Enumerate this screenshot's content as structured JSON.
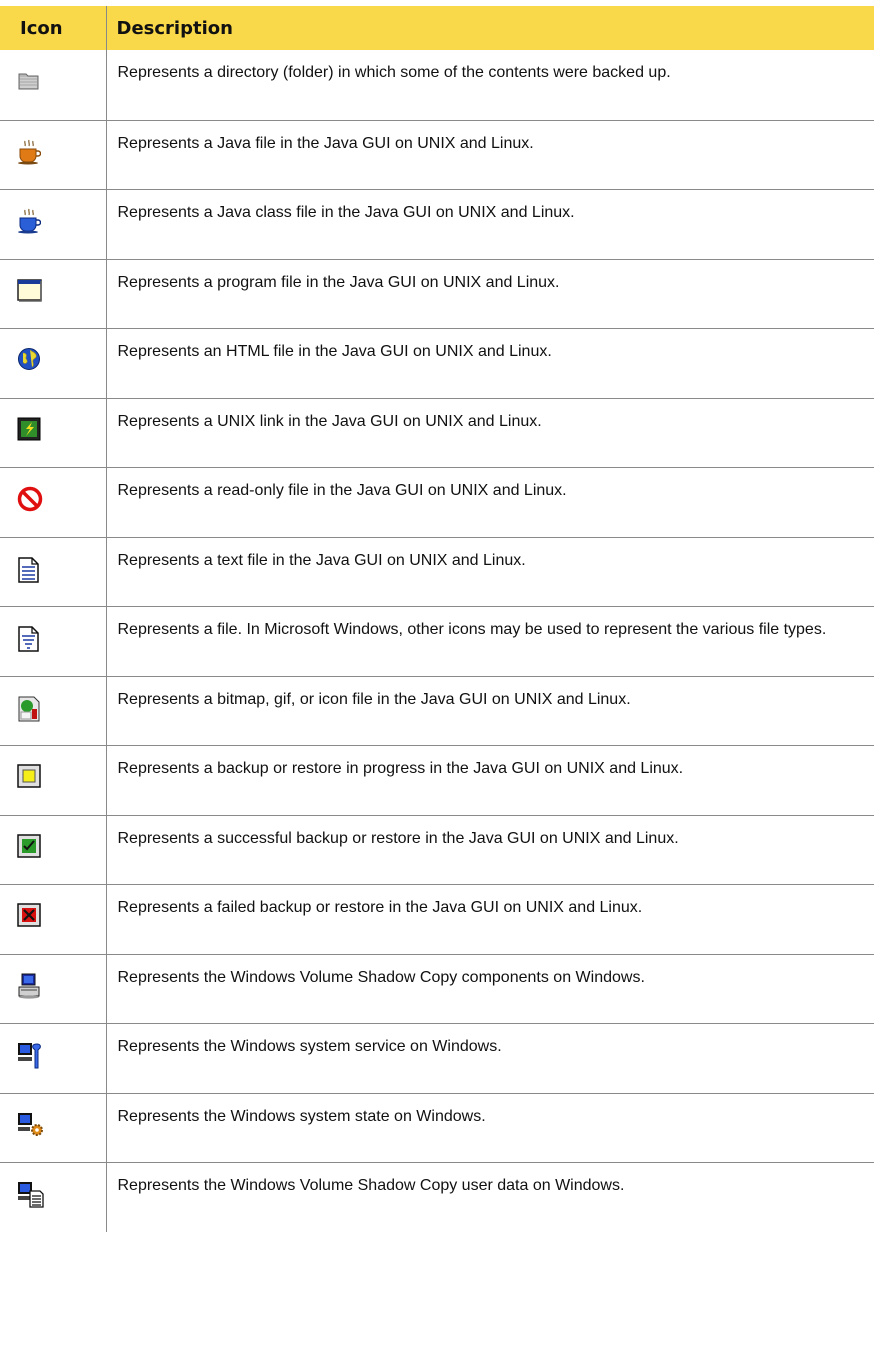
{
  "table": {
    "headers": {
      "icon": "Icon",
      "description": "Description"
    },
    "rows": [
      {
        "icon": "partial-folder-icon",
        "description": "Represents a directory (folder) in which some of the contents were backed up."
      },
      {
        "icon": "java-file-icon",
        "description": "Represents a Java file in the Java GUI on UNIX and Linux."
      },
      {
        "icon": "java-class-file-icon",
        "description": "Represents a Java class file in the Java GUI on UNIX and Linux."
      },
      {
        "icon": "program-file-icon",
        "description": "Represents a program file in the Java GUI on UNIX and Linux."
      },
      {
        "icon": "html-file-icon",
        "description": "Represents an HTML file in the Java GUI on UNIX and Linux."
      },
      {
        "icon": "unix-link-icon",
        "description": "Represents a UNIX link in the Java GUI on UNIX and Linux."
      },
      {
        "icon": "read-only-file-icon",
        "description": "Represents a read-only file in the Java GUI on UNIX and Linux."
      },
      {
        "icon": "text-file-icon",
        "description": "Represents a text file in the Java GUI on UNIX and Linux."
      },
      {
        "icon": "file-icon",
        "description": "Represents a file. In Microsoft Windows, other icons may be used to represent the various file types."
      },
      {
        "icon": "bitmap-file-icon",
        "description": "Represents a bitmap, gif, or icon file in the Java GUI on UNIX and Linux."
      },
      {
        "icon": "in-progress-icon",
        "description": "Represents a backup or restore in progress in the Java GUI on UNIX and Linux."
      },
      {
        "icon": "success-icon",
        "description": "Represents a successful backup or restore in the Java GUI on UNIX and Linux."
      },
      {
        "icon": "failed-icon",
        "description": "Represents a failed backup or restore in the Java GUI on UNIX and Linux."
      },
      {
        "icon": "shadow-copy-components-icon",
        "description": "Represents the Windows Volume Shadow Copy components on Windows."
      },
      {
        "icon": "system-service-icon",
        "description": "Represents the Windows system service on Windows."
      },
      {
        "icon": "system-state-icon",
        "description": "Represents the Windows system state on Windows."
      },
      {
        "icon": "shadow-copy-user-data-icon",
        "description": "Represents the Windows Volume Shadow Copy user data on Windows."
      }
    ]
  },
  "colors": {
    "header_bg": "#f9d84a",
    "rule": "#8a8a8a"
  }
}
